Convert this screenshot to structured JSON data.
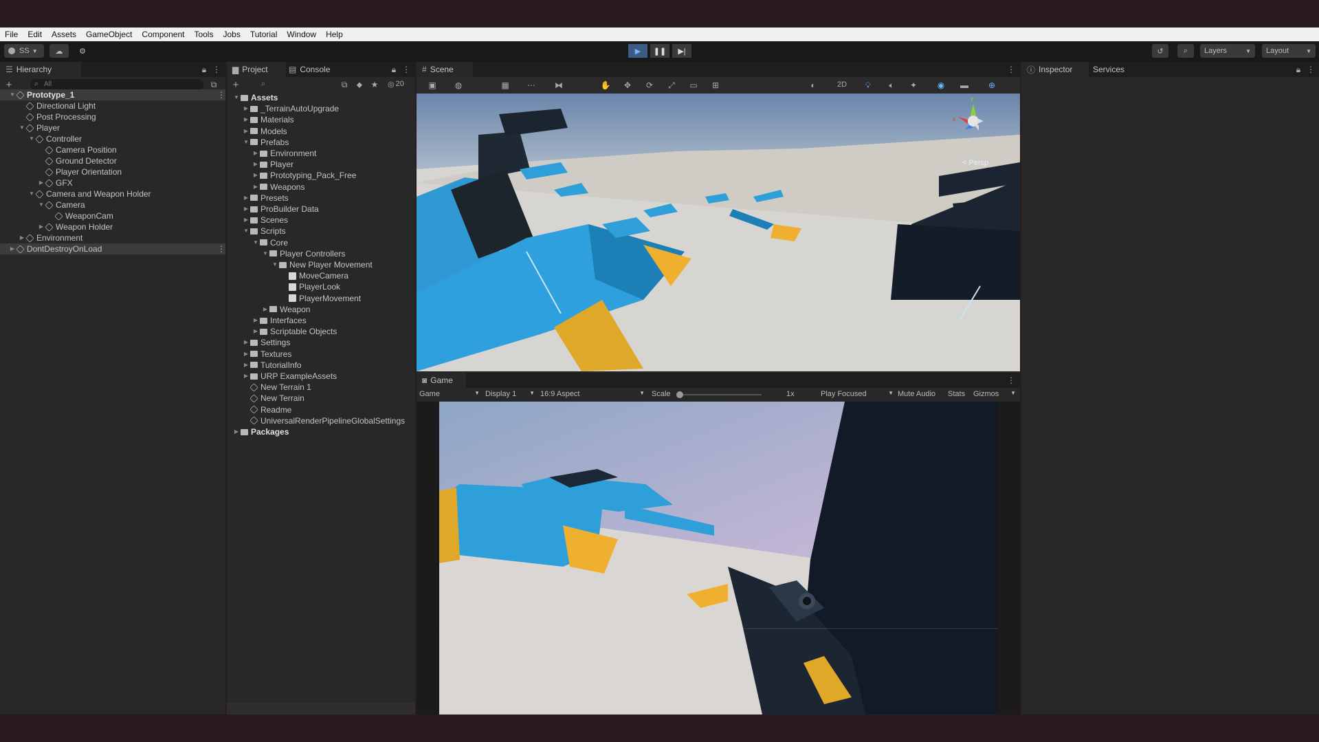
{
  "menu": [
    "File",
    "Edit",
    "Assets",
    "GameObject",
    "Component",
    "Tools",
    "Jobs",
    "Tutorial",
    "Window",
    "Help"
  ],
  "toolbar": {
    "account": "SS",
    "layers": "Layers",
    "layout": "Layout"
  },
  "hierarchy": {
    "tab": "Hierarchy",
    "search_placeholder": "All",
    "items": [
      {
        "label": "Prototype_1",
        "indent": 0,
        "fold": "open",
        "bold": true
      },
      {
        "label": "Directional Light",
        "indent": 1
      },
      {
        "label": "Post Processing",
        "indent": 1
      },
      {
        "label": "Player",
        "indent": 1,
        "fold": "open"
      },
      {
        "label": "Controller",
        "indent": 2,
        "fold": "open"
      },
      {
        "label": "Camera Position",
        "indent": 3
      },
      {
        "label": "Ground Detector",
        "indent": 3
      },
      {
        "label": "Player Orientation",
        "indent": 3
      },
      {
        "label": "GFX",
        "indent": 3,
        "fold": "closed"
      },
      {
        "label": "Camera and Weapon Holder",
        "indent": 2,
        "fold": "open"
      },
      {
        "label": "Camera",
        "indent": 3,
        "fold": "open"
      },
      {
        "label": "WeaponCam",
        "indent": 4
      },
      {
        "label": "Weapon Holder",
        "indent": 3,
        "fold": "closed"
      },
      {
        "label": "Environment",
        "indent": 1,
        "fold": "closed"
      },
      {
        "label": "DontDestroyOnLoad",
        "indent": 0,
        "fold": "closed"
      }
    ]
  },
  "project": {
    "tabs": [
      "Project",
      "Console"
    ],
    "hidden_count": "20",
    "items": [
      {
        "label": "Assets",
        "indent": 0,
        "fold": "open",
        "type": "folder",
        "bold": true
      },
      {
        "label": "_TerrainAutoUpgrade",
        "indent": 1,
        "fold": "closed",
        "type": "folder"
      },
      {
        "label": "Materials",
        "indent": 1,
        "fold": "closed",
        "type": "folder"
      },
      {
        "label": "Models",
        "indent": 1,
        "fold": "closed",
        "type": "folder"
      },
      {
        "label": "Prefabs",
        "indent": 1,
        "fold": "open",
        "type": "folder"
      },
      {
        "label": "Environment",
        "indent": 2,
        "fold": "closed",
        "type": "folder"
      },
      {
        "label": "Player",
        "indent": 2,
        "fold": "closed",
        "type": "folder"
      },
      {
        "label": "Prototyping_Pack_Free",
        "indent": 2,
        "fold": "closed",
        "type": "folder"
      },
      {
        "label": "Weapons",
        "indent": 2,
        "fold": "closed",
        "type": "folder"
      },
      {
        "label": "Presets",
        "indent": 1,
        "fold": "closed",
        "type": "folder"
      },
      {
        "label": "ProBuilder Data",
        "indent": 1,
        "fold": "closed",
        "type": "folder"
      },
      {
        "label": "Scenes",
        "indent": 1,
        "fold": "closed",
        "type": "folder"
      },
      {
        "label": "Scripts",
        "indent": 1,
        "fold": "open",
        "type": "folder"
      },
      {
        "label": "Core",
        "indent": 2,
        "fold": "open",
        "type": "folder"
      },
      {
        "label": "Player Controllers",
        "indent": 3,
        "fold": "open",
        "type": "folder"
      },
      {
        "label": "New Player Movement",
        "indent": 4,
        "fold": "open",
        "type": "folder"
      },
      {
        "label": "MoveCamera",
        "indent": 5,
        "type": "script"
      },
      {
        "label": "PlayerLook",
        "indent": 5,
        "type": "script"
      },
      {
        "label": "PlayerMovement",
        "indent": 5,
        "type": "script"
      },
      {
        "label": "Weapon",
        "indent": 3,
        "fold": "closed",
        "type": "folder"
      },
      {
        "label": "Interfaces",
        "indent": 2,
        "fold": "closed",
        "type": "folder"
      },
      {
        "label": "Scriptable Objects",
        "indent": 2,
        "fold": "closed",
        "type": "folder"
      },
      {
        "label": "Settings",
        "indent": 1,
        "fold": "closed",
        "type": "folder"
      },
      {
        "label": "Textures",
        "indent": 1,
        "fold": "closed",
        "type": "folder"
      },
      {
        "label": "TutorialInfo",
        "indent": 1,
        "fold": "closed",
        "type": "folder"
      },
      {
        "label": "URP ExampleAssets",
        "indent": 1,
        "fold": "closed",
        "type": "folder"
      },
      {
        "label": "New Terrain 1",
        "indent": 1,
        "type": "terrain"
      },
      {
        "label": "New Terrain",
        "indent": 1,
        "type": "terrain"
      },
      {
        "label": "Readme",
        "indent": 1,
        "type": "asset"
      },
      {
        "label": "UniversalRenderPipelineGlobalSettings",
        "indent": 1,
        "type": "asset"
      },
      {
        "label": "Packages",
        "indent": 0,
        "fold": "closed",
        "type": "folder",
        "bold": true
      }
    ]
  },
  "scene": {
    "tab": "Scene",
    "gizmo_2d": "2D",
    "persp": "< Persp",
    "axis_x": "x",
    "axis_y": "y",
    "axis_z": "z"
  },
  "game": {
    "tab": "Game",
    "mode": "Game",
    "display": "Display 1",
    "aspect": "16:9 Aspect",
    "scale_label": "Scale",
    "scale_value": "1x",
    "play_focused": "Play Focused",
    "mute": "Mute Audio",
    "stats": "Stats",
    "gizmos": "Gizmos"
  },
  "inspector": {
    "tabs": [
      "Inspector",
      "Services"
    ]
  }
}
